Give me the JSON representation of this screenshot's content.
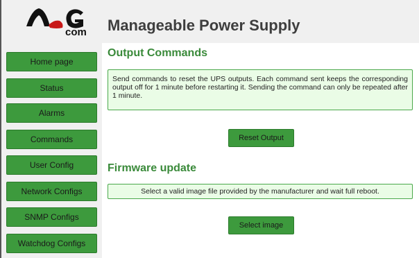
{
  "header": {
    "logo": {
      "text_top": "ALG",
      "text_bottom": "com"
    },
    "title": "Manageable Power Supply"
  },
  "sidebar": {
    "items": [
      {
        "label": "Home page"
      },
      {
        "label": "Status"
      },
      {
        "label": "Alarms"
      },
      {
        "label": "Commands"
      },
      {
        "label": "User Config"
      },
      {
        "label": "Network Configs"
      },
      {
        "label": "SNMP Configs"
      },
      {
        "label": "Watchdog Configs"
      }
    ]
  },
  "output_commands": {
    "title": "Output Commands",
    "description": "Send commands to reset the UPS outputs. Each command sent keeps the corresponding output off for 1 minute before restarting it. Sending the command can only be repeated after 1 minute.",
    "button_label": "Reset Output"
  },
  "firmware_update": {
    "title": "Firmware update",
    "description": "Select a valid image file provided by the manufacturer and wait full reboot.",
    "button_label": "Select image"
  },
  "colors": {
    "accent_green": "#3d9a3d",
    "section_title_green": "#3a8a3a",
    "info_box_bg": "#eafce6",
    "logo_red": "#c81818",
    "logo_dark": "#111111"
  }
}
